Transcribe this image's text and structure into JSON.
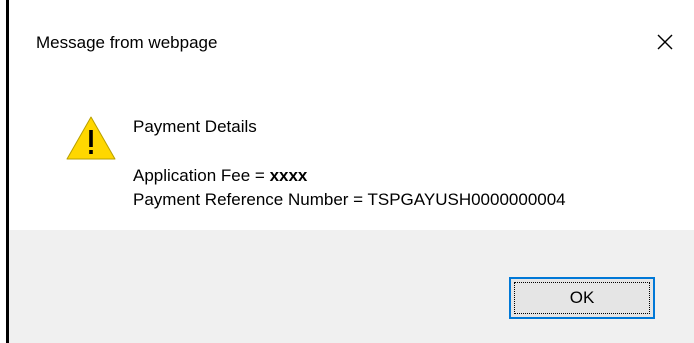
{
  "dialog": {
    "title": "Message from webpage",
    "close_icon": "close-icon",
    "warning_icon": "warning-icon",
    "message": {
      "heading": "Payment Details",
      "fee_label": "Application Fee = ",
      "fee_value": "xxxx",
      "reference_line": "Payment Reference Number = TSPGAYUSH0000000004"
    },
    "ok_label": "OK"
  },
  "colors": {
    "footer_bg": "#f0f0f0",
    "button_border": "#0078d7",
    "warning_fill": "#ffd700"
  }
}
